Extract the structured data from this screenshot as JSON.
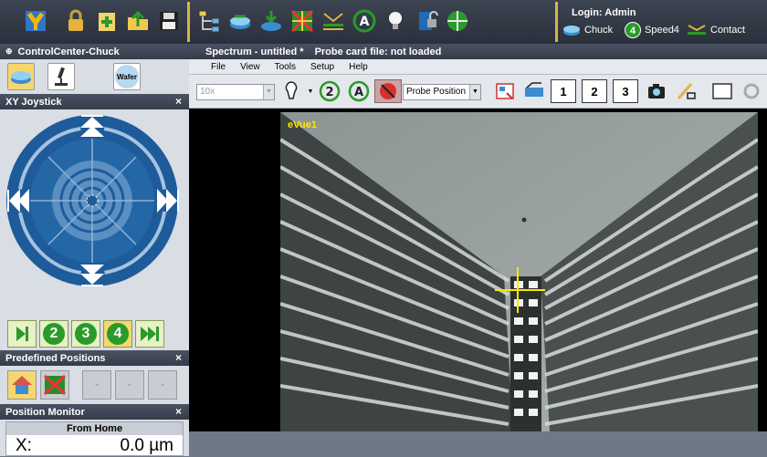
{
  "topbar": {
    "login": "Login: Admin",
    "status": [
      {
        "label": "Chuck",
        "icon": "chuck-icon"
      },
      {
        "label": "Speed4",
        "icon": "speed-4-icon",
        "badge": "4"
      },
      {
        "label": "Contact",
        "icon": "contact-icon"
      }
    ]
  },
  "left_panel": {
    "control_center_title": "ControlCenter-Chuck",
    "wafer_label": "Wafer",
    "joystick_title": "XY Joystick",
    "step_buttons": [
      "2",
      "3",
      "4"
    ],
    "predefined_title": "Predefined Positions",
    "predefined_placeholders": [
      "-",
      "-",
      "-"
    ],
    "monitor_title": "Position Monitor",
    "monitor_header": "From Home",
    "monitor_axis": "X:",
    "monitor_value": "0.0 µm",
    "close_glyph": "×"
  },
  "main_window": {
    "title": "Spectrum - untitled *",
    "probe_card": "Probe card file: not loaded",
    "menu": [
      "File",
      "View",
      "Tools",
      "Setup",
      "Help"
    ],
    "zoom_value": "10x",
    "mode_select": "Probe Position",
    "tool_numbers": [
      "1",
      "2",
      "3"
    ],
    "camera_label": "eVue1"
  },
  "colors": {
    "accent_gold": "#d7b448",
    "joystick_blue": "#1e5b9a",
    "crosshair": "#ffe600"
  }
}
